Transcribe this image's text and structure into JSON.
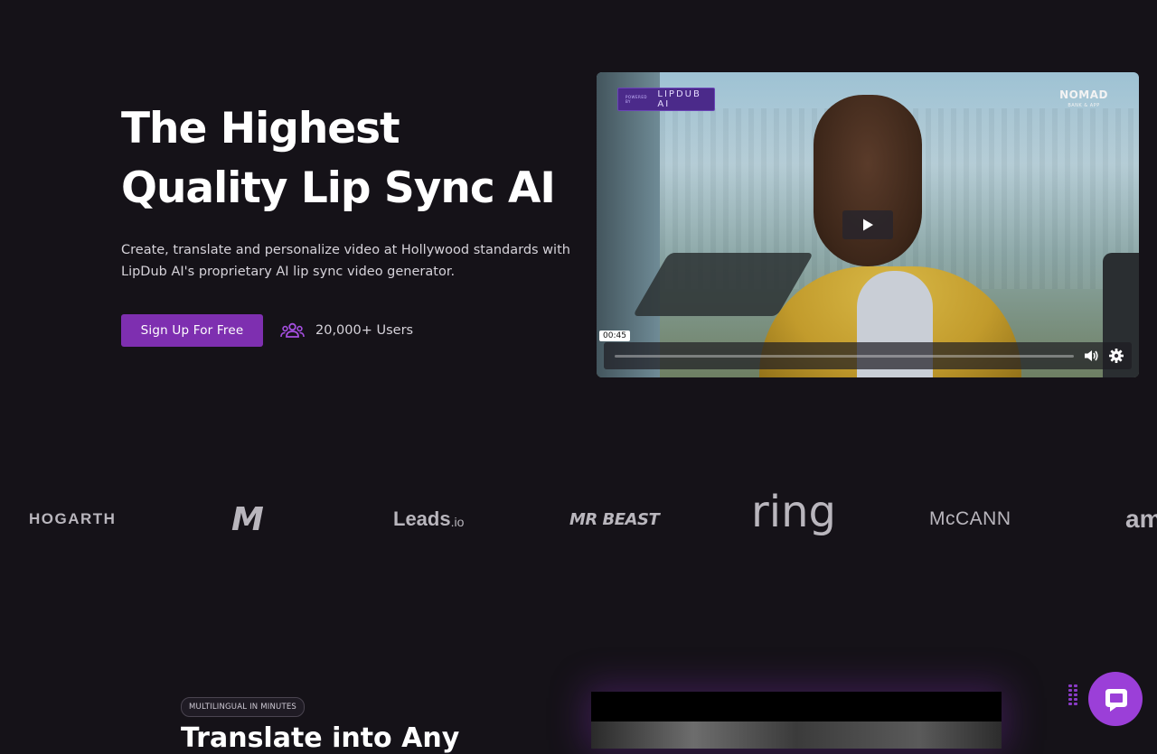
{
  "hero": {
    "title_line1": "The Highest",
    "title_line2": "Quality Lip Sync AI",
    "subtitle_line1": "Create, translate and personalize video at Hollywood standards with",
    "subtitle_line2": "LipDub AI's proprietary AI lip sync video generator.",
    "cta_label": "Sign Up For Free",
    "users_count": "20,000+ Users"
  },
  "video": {
    "badge_small": "POWERED BY",
    "badge_brand": "LIPDUB AI",
    "corner_logo": "NOMAD",
    "corner_logo_sub": "BANK & APP",
    "timestamp": "00:45",
    "progress": 0.0,
    "icons": [
      "play-icon",
      "volume-icon",
      "settings-icon"
    ]
  },
  "logos": [
    "HOGARTH",
    "M",
    "Leads",
    ".io",
    "MR BEAST",
    "ring",
    "McCANN",
    "am"
  ],
  "section": {
    "tag": "MULTILINGUAL IN MINUTES",
    "title": "Translate into Any"
  },
  "colors": {
    "background": "#151218",
    "accent": "#7e2fb0",
    "chat": "#9b3fd8",
    "logo_gray": "#b9b6bd"
  }
}
